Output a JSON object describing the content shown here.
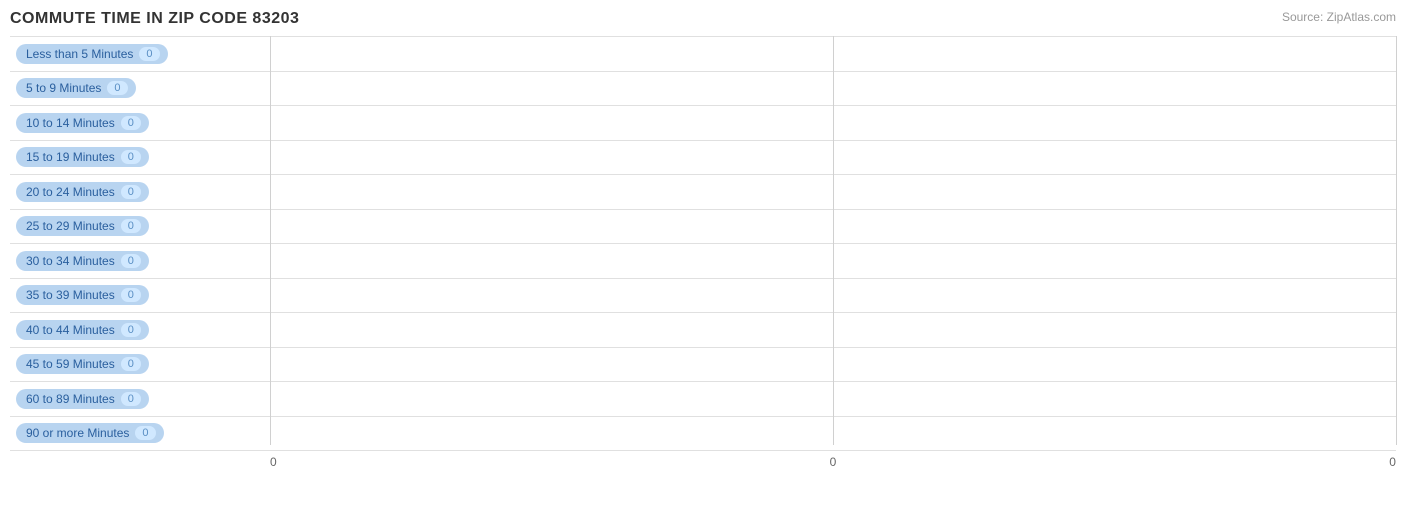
{
  "chart": {
    "title": "COMMUTE TIME IN ZIP CODE 83203",
    "source": "Source: ZipAtlas.com",
    "bars": [
      {
        "label": "Less than 5 Minutes",
        "value": 0
      },
      {
        "label": "5 to 9 Minutes",
        "value": 0
      },
      {
        "label": "10 to 14 Minutes",
        "value": 0
      },
      {
        "label": "15 to 19 Minutes",
        "value": 0
      },
      {
        "label": "20 to 24 Minutes",
        "value": 0
      },
      {
        "label": "25 to 29 Minutes",
        "value": 0
      },
      {
        "label": "30 to 34 Minutes",
        "value": 0
      },
      {
        "label": "35 to 39 Minutes",
        "value": 0
      },
      {
        "label": "40 to 44 Minutes",
        "value": 0
      },
      {
        "label": "45 to 59 Minutes",
        "value": 0
      },
      {
        "label": "60 to 89 Minutes",
        "value": 0
      },
      {
        "label": "90 or more Minutes",
        "value": 0
      }
    ],
    "x_axis_labels": [
      "0",
      "0",
      "0"
    ],
    "x_axis_positions": [
      0,
      50,
      100
    ]
  }
}
